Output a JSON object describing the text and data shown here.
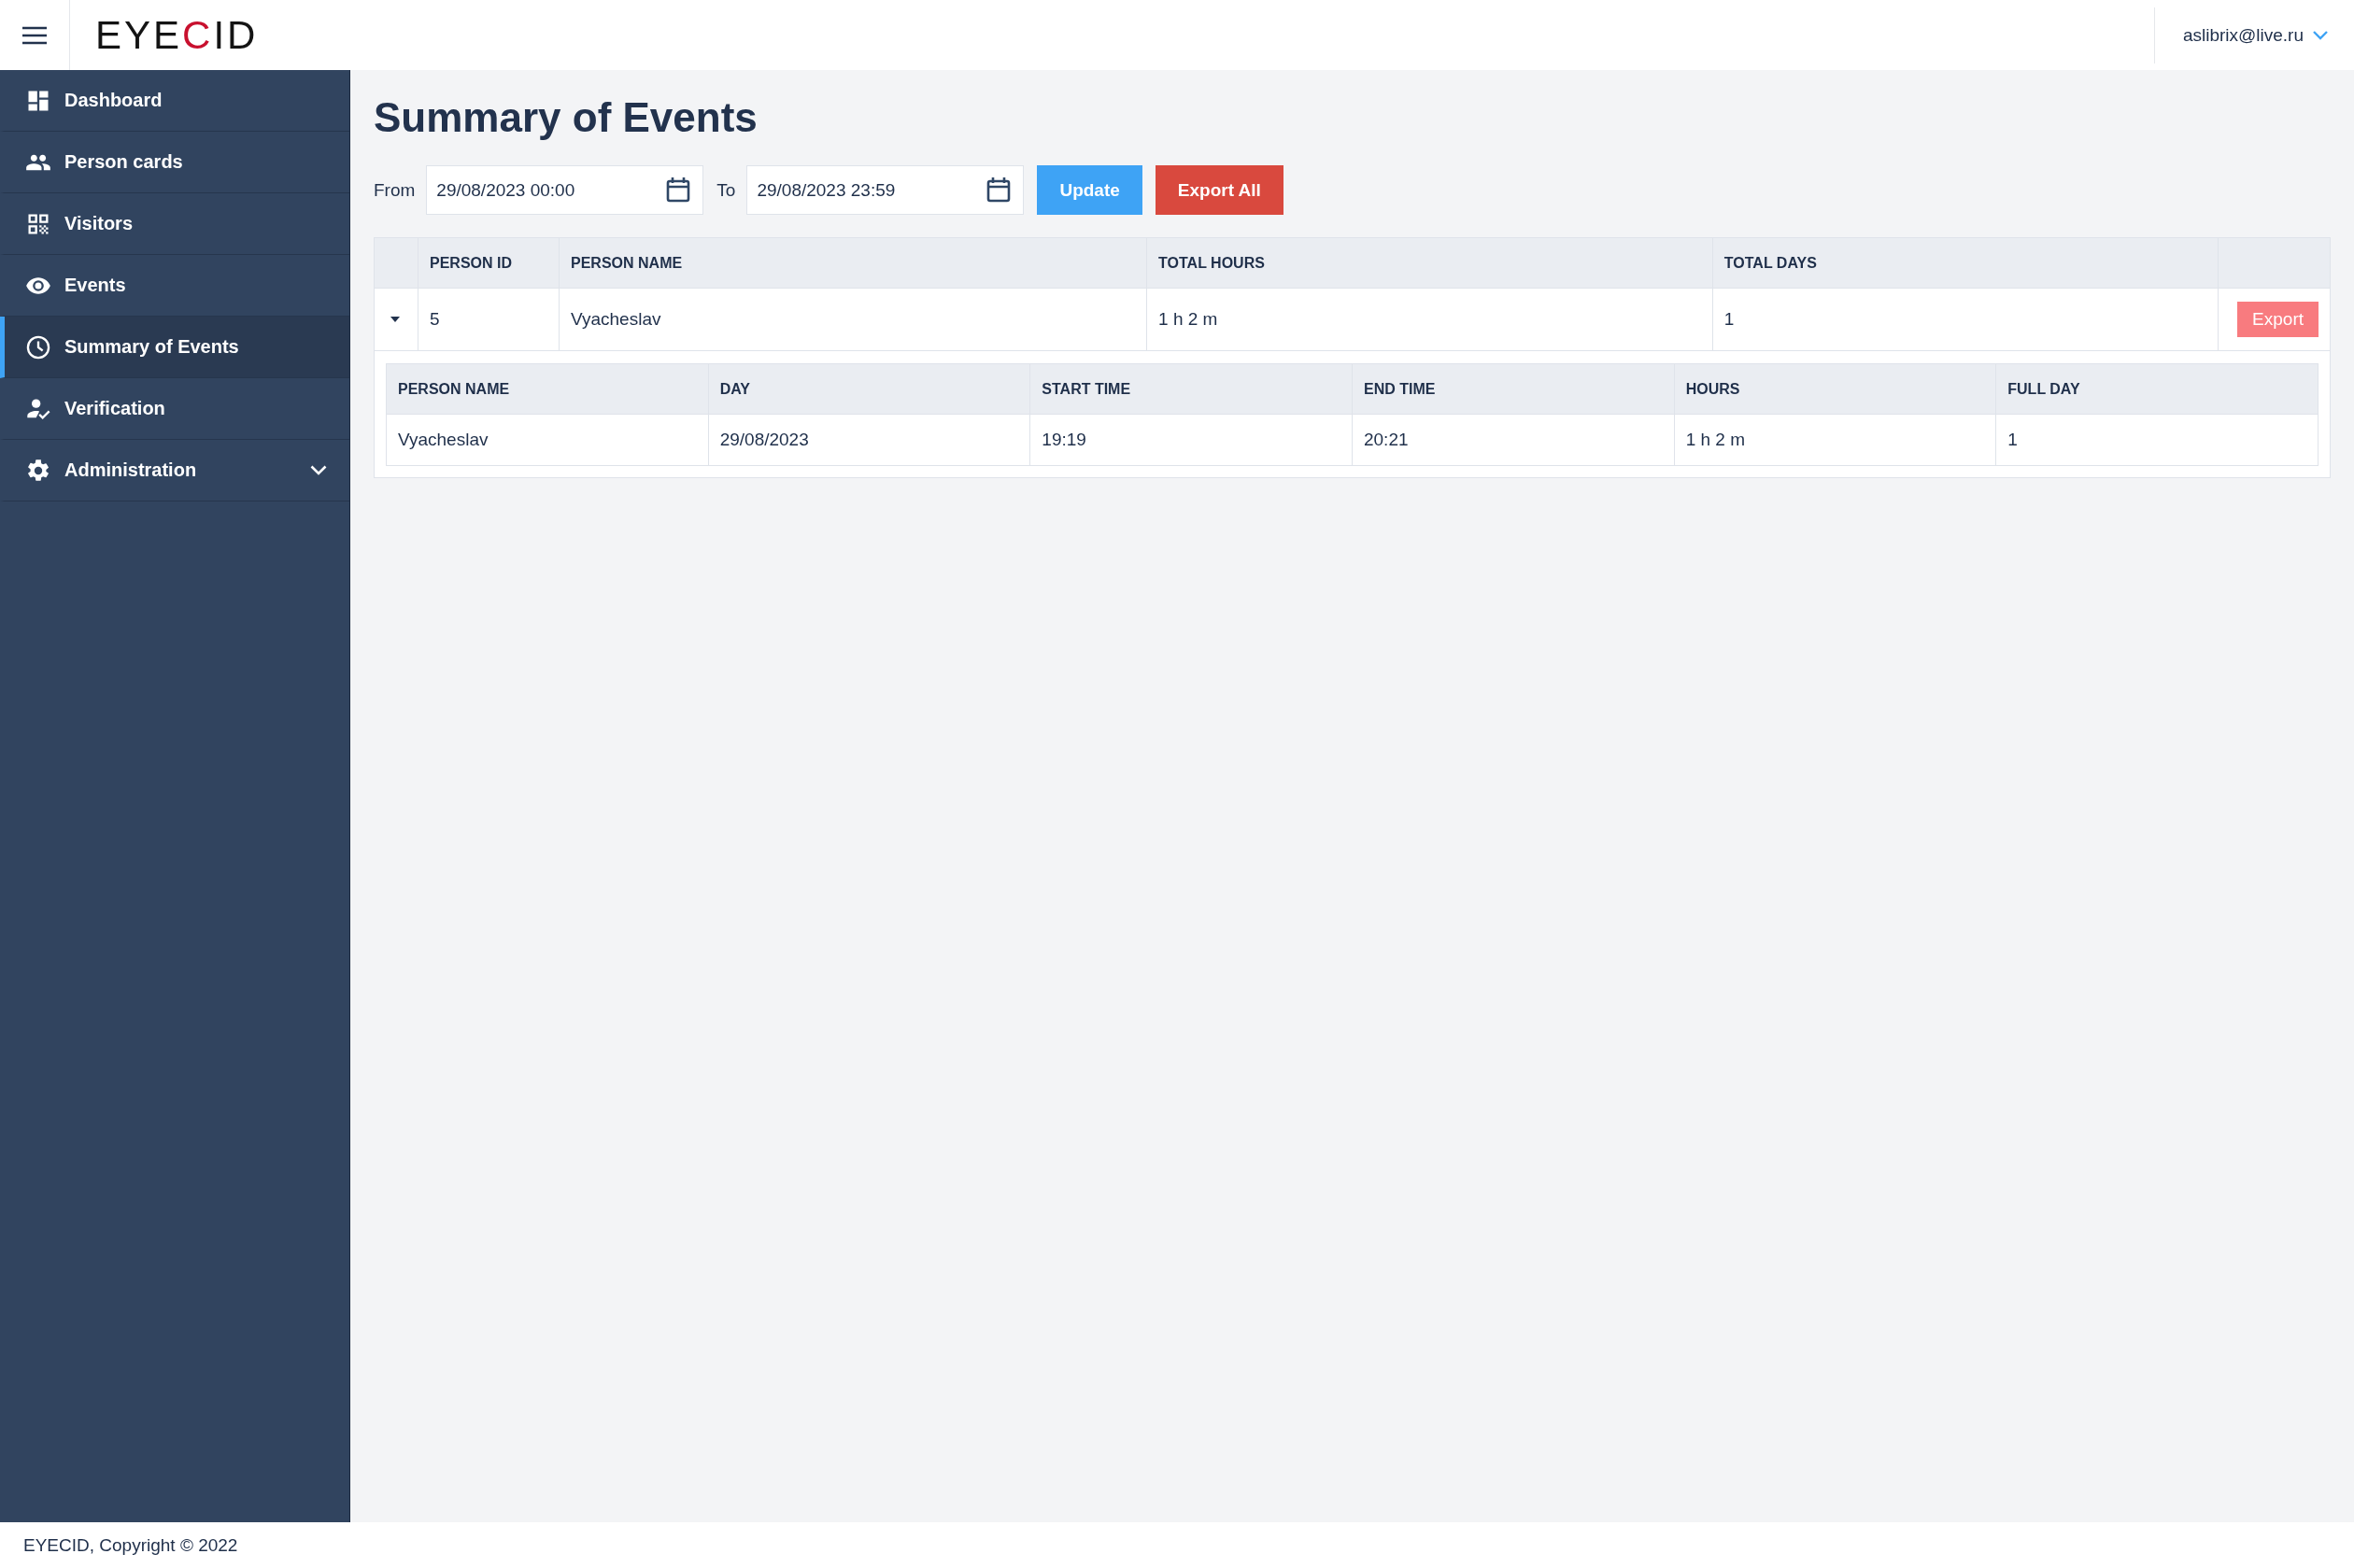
{
  "header": {
    "logo": [
      {
        "text": "EYE"
      },
      {
        "text": "C",
        "color": "#c8102e"
      },
      {
        "text": "ID"
      }
    ],
    "user": "aslibrix@live.ru"
  },
  "sidebar": {
    "items": [
      {
        "label": "Dashboard",
        "kind": "link",
        "selected": false
      },
      {
        "label": "Person cards",
        "kind": "link",
        "selected": false
      },
      {
        "label": "Visitors",
        "kind": "link",
        "selected": false
      },
      {
        "label": "Events",
        "kind": "link",
        "selected": false
      },
      {
        "label": "Summary of Events",
        "kind": "link",
        "selected": true
      },
      {
        "label": "Verification",
        "kind": "link",
        "selected": false
      },
      {
        "label": "Administration",
        "kind": "group",
        "selected": false
      }
    ]
  },
  "page": {
    "title": "Summary of Events",
    "filters": {
      "from_label": "From",
      "from_value": "29/08/2023 00:00",
      "to_label": "To",
      "to_value": "29/08/2023 23:59"
    },
    "buttons": [
      {
        "label": "Update",
        "kind": "primary"
      },
      {
        "label": "Export All",
        "kind": "danger"
      }
    ]
  },
  "table": {
    "columns": [
      "PERSON ID",
      "PERSON NAME",
      "TOTAL HOURS",
      "TOTAL DAYS"
    ],
    "rows": [
      {
        "expanded": true,
        "cells": [
          "5",
          "Vyacheslav",
          "1 h 2 m",
          "1"
        ],
        "action": "Export",
        "detail": {
          "columns": [
            "PERSON NAME",
            "DAY",
            "START TIME",
            "END TIME",
            "HOURS",
            "FULL DAY"
          ],
          "rows": [
            [
              "Vyacheslav",
              "29/08/2023",
              "19:19",
              "20:21",
              "1 h 2 m",
              "1"
            ]
          ]
        }
      }
    ]
  },
  "footer": "EYECID, Copyright © 2022"
}
